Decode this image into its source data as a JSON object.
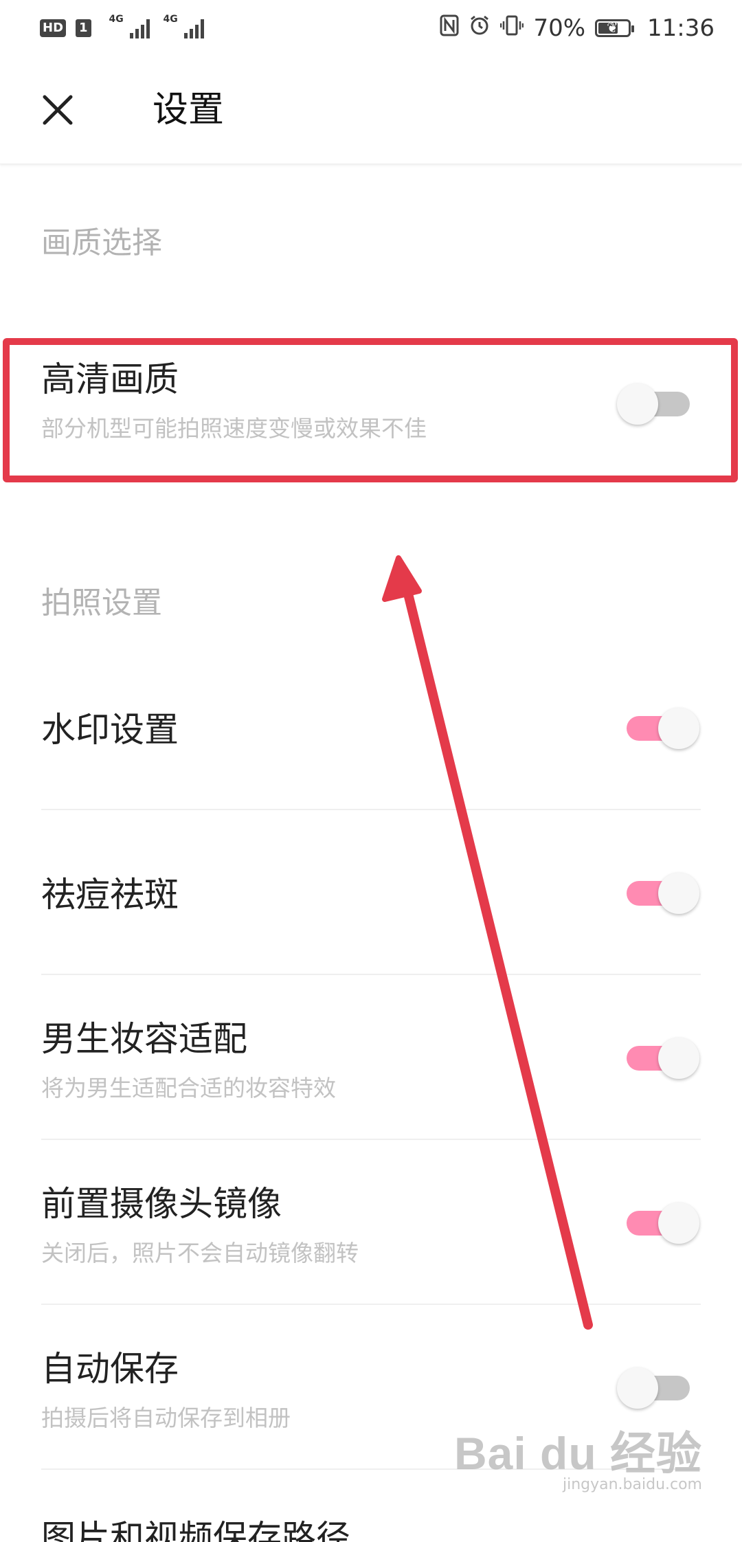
{
  "status_bar": {
    "hd": "HD",
    "sim": "1",
    "net1": "4G",
    "net2": "4G",
    "battery": "70%",
    "battery_level": 0.7,
    "time": "11:36"
  },
  "header": {
    "title": "设置"
  },
  "sections": {
    "quality": {
      "header": "画质选择"
    },
    "photo": {
      "header": "拍照设置"
    }
  },
  "settings": [
    {
      "title": "高清画质",
      "subtitle": "部分机型可能拍照速度变慢或效果不佳",
      "on": false
    },
    {
      "title": "水印设置",
      "subtitle": "",
      "on": true
    },
    {
      "title": "祛痘祛斑",
      "subtitle": "",
      "on": true
    },
    {
      "title": "男生妆容适配",
      "subtitle": "将为男生适配合适的妆容特效",
      "on": true
    },
    {
      "title": "前置摄像头镜像",
      "subtitle": "关闭后，照片不会自动镜像翻转",
      "on": true
    },
    {
      "title": "自动保存",
      "subtitle": "拍摄后将自动保存到相册",
      "on": false
    }
  ],
  "cut_row": {
    "title": "图片和视频保存路径"
  },
  "colors": {
    "toggle_on": "#ff8bb2",
    "toggle_off": "#c6c6c6",
    "annotation": "#e43a4a"
  },
  "watermark": {
    "logo": "Bai du 经验",
    "sub": "jingyan.baidu.com"
  }
}
